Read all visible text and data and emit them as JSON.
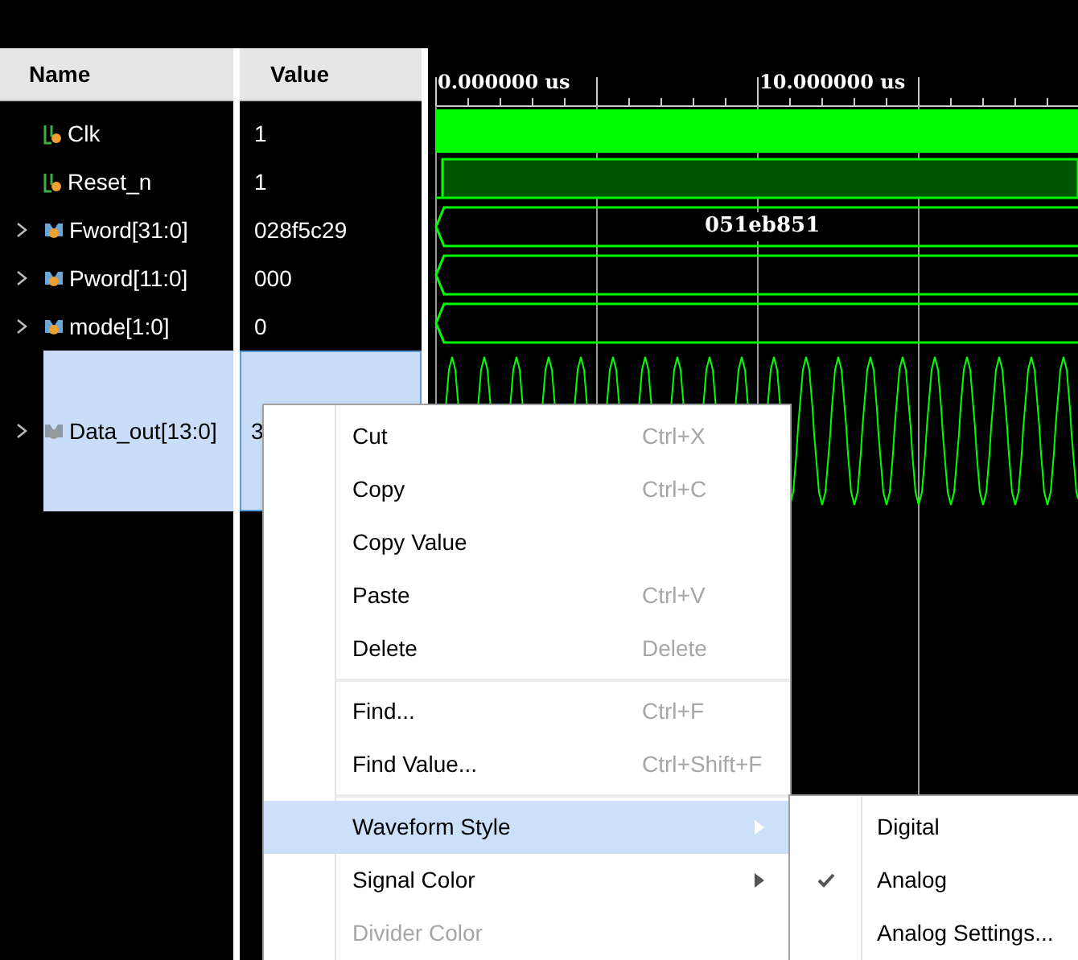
{
  "columns": {
    "name": "Name",
    "value": "Value"
  },
  "ruler": {
    "labels": [
      "0.000000 us",
      "10.000000 us"
    ]
  },
  "signals": [
    {
      "name": "Clk",
      "value": "1",
      "kind": "clock",
      "expandable": false,
      "selected": false
    },
    {
      "name": "Reset_n",
      "value": "1",
      "kind": "reset",
      "expandable": false,
      "selected": false
    },
    {
      "name": "Fword[31:0]",
      "value": "028f5c29",
      "kind": "bus",
      "expandable": true,
      "selected": false,
      "wave_label": "051eb851"
    },
    {
      "name": "Pword[11:0]",
      "value": "000",
      "kind": "bus",
      "expandable": true,
      "selected": false
    },
    {
      "name": "mode[1:0]",
      "value": "0",
      "kind": "bus",
      "expandable": true,
      "selected": false
    },
    {
      "name": "Data_out[13:0]",
      "value": "3",
      "kind": "analog",
      "expandable": true,
      "selected": true
    }
  ],
  "context_menu": {
    "items": [
      {
        "kind": "item",
        "label": "Cut",
        "shortcut": "Ctrl+X",
        "disabled": false,
        "selected": false
      },
      {
        "kind": "item",
        "label": "Copy",
        "shortcut": "Ctrl+C",
        "disabled": false,
        "selected": false
      },
      {
        "kind": "item",
        "label": "Copy Value",
        "disabled": false,
        "selected": false
      },
      {
        "kind": "item",
        "label": "Paste",
        "shortcut": "Ctrl+V",
        "disabled": false,
        "selected": false
      },
      {
        "kind": "item",
        "label": "Delete",
        "shortcut": "Delete",
        "disabled": false,
        "selected": false
      },
      {
        "kind": "separator"
      },
      {
        "kind": "item",
        "label": "Find...",
        "shortcut": "Ctrl+F",
        "disabled": false,
        "selected": false
      },
      {
        "kind": "item",
        "label": "Find Value...",
        "shortcut": "Ctrl+Shift+F",
        "disabled": false,
        "selected": false
      },
      {
        "kind": "separator"
      },
      {
        "kind": "submenu",
        "label": "Waveform Style",
        "disabled": false,
        "selected": true
      },
      {
        "kind": "submenu",
        "label": "Signal Color",
        "disabled": false,
        "selected": false
      },
      {
        "kind": "item",
        "label": "Divider Color",
        "disabled": true,
        "selected": false
      }
    ]
  },
  "submenu": {
    "items": [
      {
        "label": "Digital",
        "checked": false
      },
      {
        "label": "Analog",
        "checked": true
      },
      {
        "label": "Analog Settings...",
        "checked": false
      }
    ]
  }
}
